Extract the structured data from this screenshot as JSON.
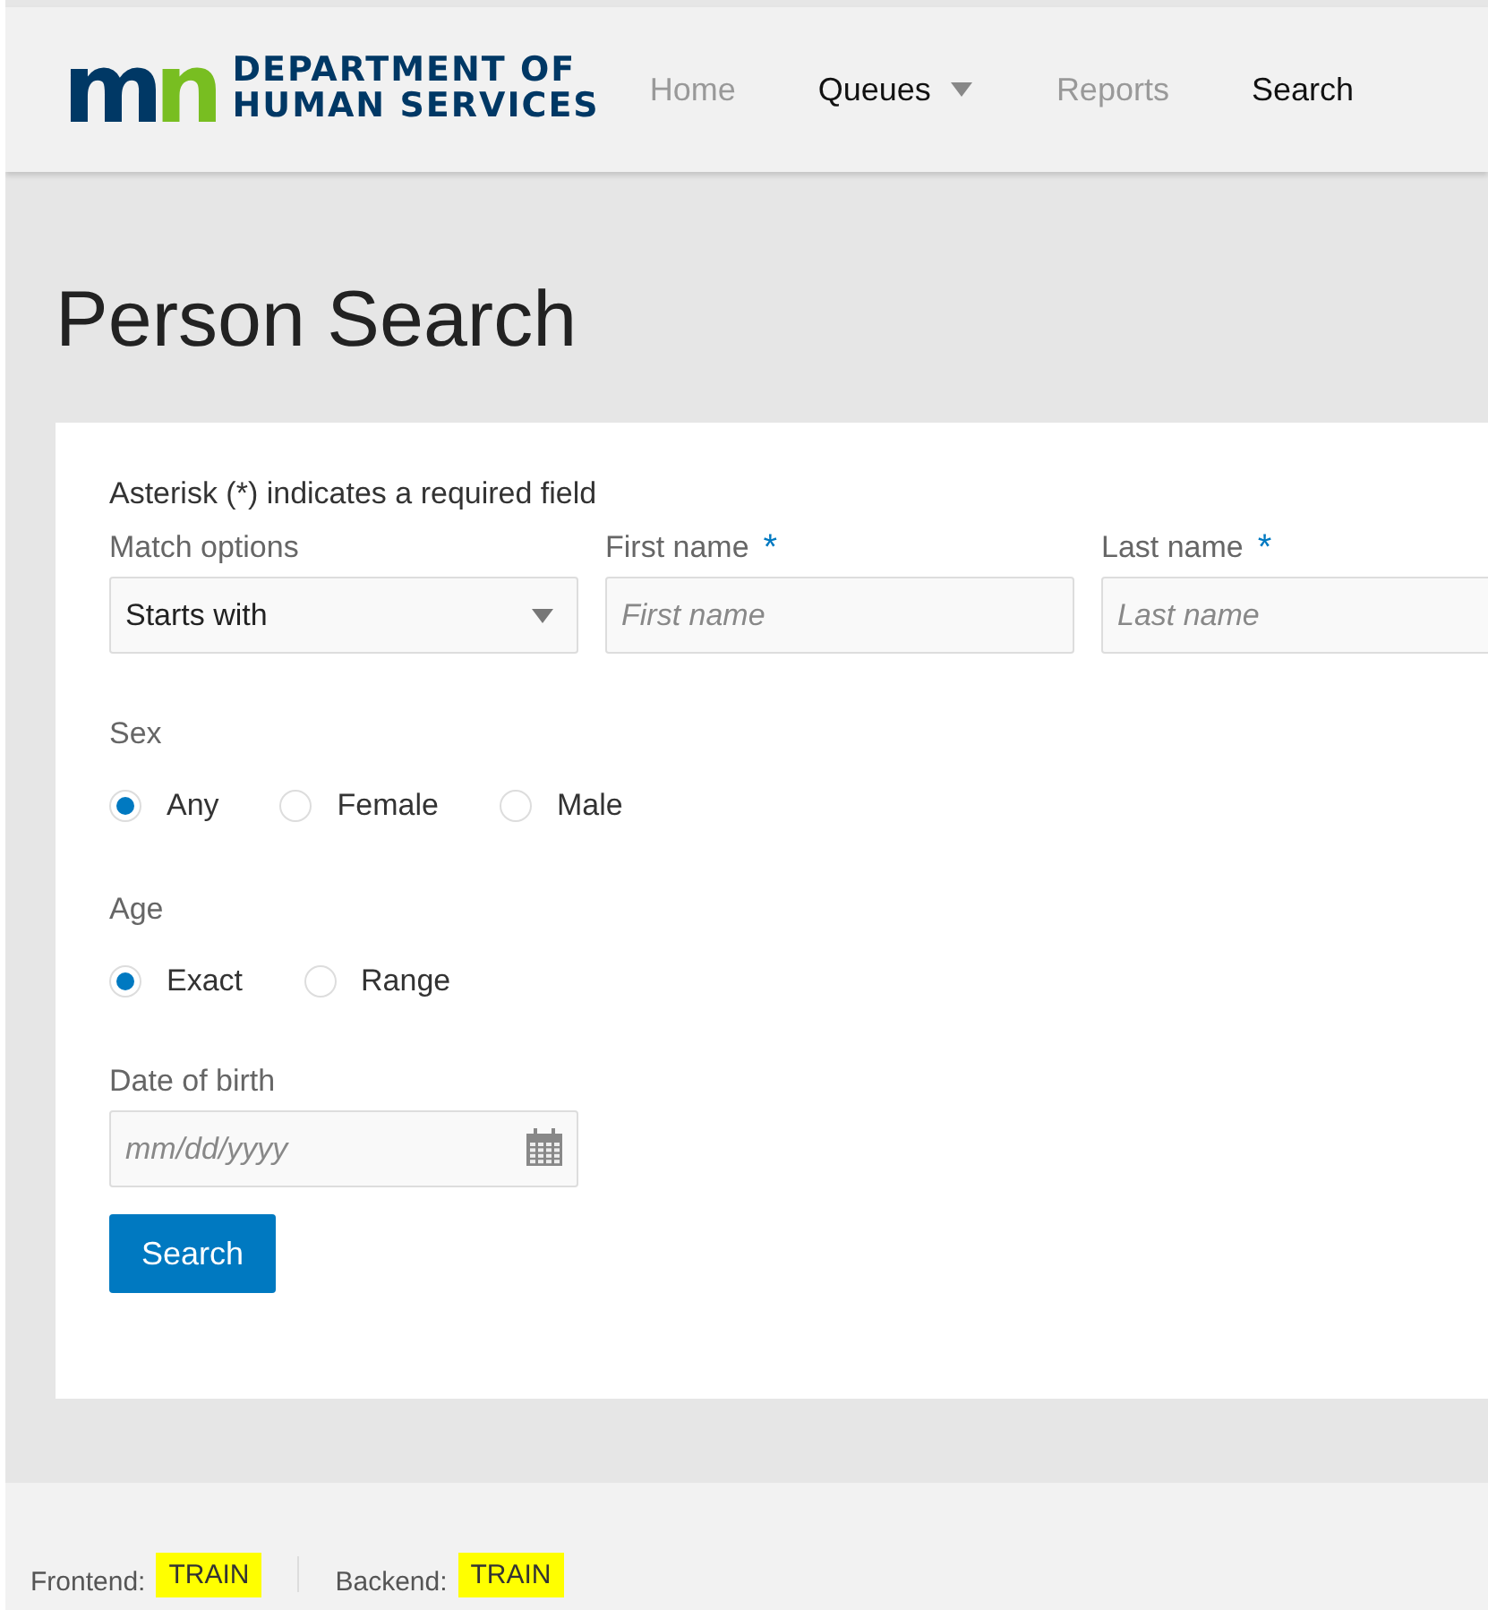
{
  "header": {
    "logo": {
      "mark_left": "m",
      "mark_right": "n",
      "line_1": "DEPARTMENT OF",
      "line_2": "HUMAN SERVICES"
    },
    "nav": [
      {
        "label": "Home",
        "disabled": true,
        "dropdown": false
      },
      {
        "label": "Queues",
        "disabled": false,
        "dropdown": true
      },
      {
        "label": "Reports",
        "disabled": true,
        "dropdown": false
      },
      {
        "label": "Search",
        "disabled": false,
        "dropdown": false
      }
    ]
  },
  "page_title": "Person Search",
  "form": {
    "note": "Asterisk (*) indicates a required field",
    "fields": [
      {
        "kind": "select",
        "label": "Match options",
        "value": "Starts with"
      },
      {
        "kind": "text",
        "label": "First name",
        "required_mark": "*",
        "placeholder": "First name"
      },
      {
        "kind": "text",
        "label": "Last name",
        "required_mark": "*",
        "placeholder": "Last name"
      }
    ],
    "radio_groups": [
      {
        "label": "Sex",
        "options": [
          {
            "label": "Any",
            "selected": true
          },
          {
            "label": "Female",
            "selected": false
          },
          {
            "label": "Male",
            "selected": false
          }
        ]
      },
      {
        "label": "Age",
        "options": [
          {
            "label": "Exact",
            "selected": true
          },
          {
            "label": "Range",
            "selected": false
          }
        ]
      }
    ],
    "date_field": {
      "label": "Date of birth",
      "placeholder": "mm/dd/yyyy"
    },
    "submit": "Search"
  },
  "footer": [
    {
      "label": "Frontend:",
      "value": "TRAIN"
    },
    {
      "label": "Backend:",
      "value": "TRAIN"
    }
  ]
}
